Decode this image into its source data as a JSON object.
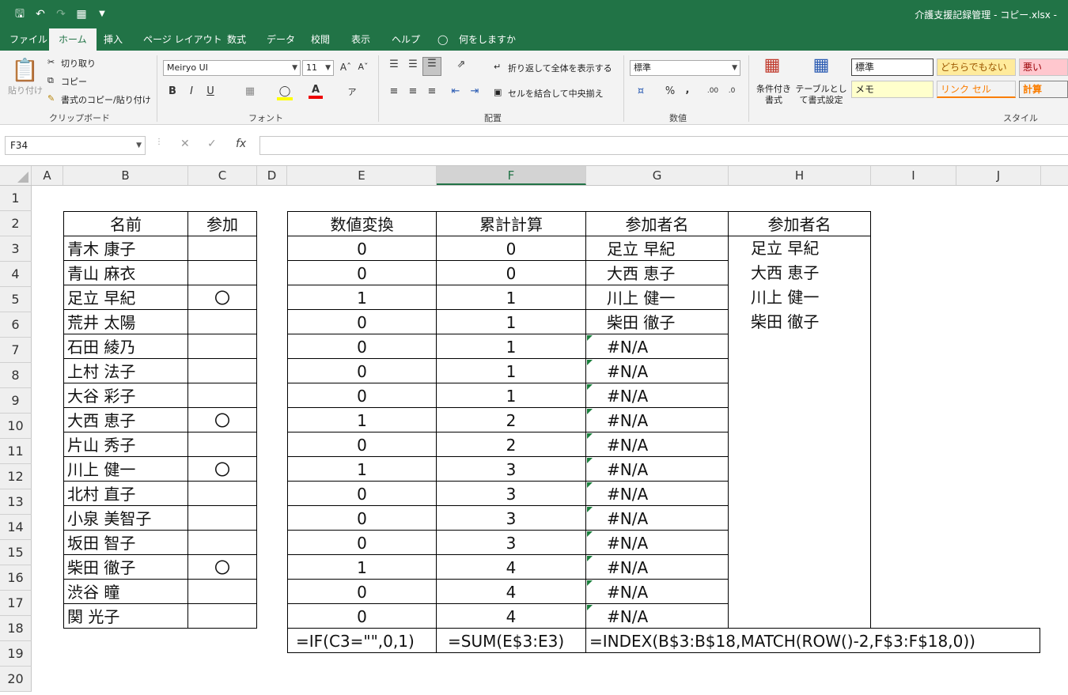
{
  "window": {
    "title": "介護支援記録管理 - コピー.xlsx  -"
  },
  "qat": {
    "save_icon": "save-icon",
    "undo_icon": "undo-icon",
    "redo_icon": "redo-icon",
    "form_icon": "form-icon",
    "customize_icon": "customize-icon"
  },
  "menu": {
    "items": [
      "ファイル",
      "ホーム",
      "挿入",
      "ページ レイアウト",
      "数式",
      "データ",
      "校閲",
      "表示",
      "ヘルプ"
    ],
    "tellme": "何をしますか",
    "active": "ホーム"
  },
  "ribbon": {
    "clipboard": {
      "paste": "貼り付け",
      "cut": "切り取り",
      "copy": "コピー",
      "format_painter": "書式のコピー/貼り付け",
      "label": "クリップボード"
    },
    "font": {
      "name": "Meiryo UI",
      "size": "11",
      "bold": "B",
      "italic": "I",
      "underline": "U",
      "label": "フォント"
    },
    "alignment": {
      "wrap": "折り返して全体を表示する",
      "merge": "セルを結合して中央揃え",
      "label": "配置"
    },
    "number": {
      "format": "標準",
      "label": "数値"
    },
    "styles": {
      "conditional": "条件付き書式",
      "table": "テーブルとして書式設定",
      "normal": "標準",
      "neutral": "どちらでもない",
      "bad": "悪い",
      "memo": "メモ",
      "link_cell": "リンク セル",
      "calc": "計算",
      "label": "スタイル"
    },
    "colors": {
      "neutral_bg": "#ffeb9c",
      "bad_bg": "#ffc7ce",
      "memo_bg": "#ffffcc",
      "calc_bg": "#f2f2f2"
    }
  },
  "formula_bar": {
    "name_box": "F34",
    "cancel": "✕",
    "enter": "✓",
    "fx": "fx",
    "content": ""
  },
  "columns": [
    "A",
    "B",
    "C",
    "D",
    "E",
    "F",
    "G",
    "H",
    "I",
    "J"
  ],
  "selected_column": "F",
  "rows": [
    "1",
    "2",
    "3",
    "4",
    "5",
    "6",
    "7",
    "8",
    "9",
    "10",
    "11",
    "12",
    "13",
    "14",
    "15",
    "16",
    "17",
    "18",
    "19",
    "20"
  ],
  "table1": {
    "header": {
      "name": "名前",
      "join": "参加"
    },
    "rows": [
      {
        "name": "青木 康子",
        "join": ""
      },
      {
        "name": "青山 麻衣",
        "join": ""
      },
      {
        "name": "足立 早紀",
        "join": "〇"
      },
      {
        "name": "荒井 太陽",
        "join": ""
      },
      {
        "name": "石田 綾乃",
        "join": ""
      },
      {
        "name": "上村 法子",
        "join": ""
      },
      {
        "name": "大谷 彩子",
        "join": ""
      },
      {
        "name": "大西 恵子",
        "join": "〇"
      },
      {
        "name": "片山 秀子",
        "join": ""
      },
      {
        "name": "川上 健一",
        "join": "〇"
      },
      {
        "name": "北村 直子",
        "join": ""
      },
      {
        "name": "小泉 美智子",
        "join": ""
      },
      {
        "name": "坂田 智子",
        "join": ""
      },
      {
        "name": "柴田 徹子",
        "join": "〇"
      },
      {
        "name": "渋谷 瞳",
        "join": ""
      },
      {
        "name": "関 光子",
        "join": ""
      }
    ]
  },
  "table2": {
    "header": {
      "e": "数値変換",
      "f": "累計計算",
      "g": "参加者名",
      "h": "参加者名"
    },
    "rows": [
      {
        "e": "0",
        "f": "0",
        "g": "足立 早紀",
        "h": "足立 早紀"
      },
      {
        "e": "0",
        "f": "0",
        "g": "大西 恵子",
        "h": "大西 恵子"
      },
      {
        "e": "1",
        "f": "1",
        "g": "川上 健一",
        "h": "川上 健一"
      },
      {
        "e": "0",
        "f": "1",
        "g": "柴田 徹子",
        "h": "柴田 徹子"
      },
      {
        "e": "0",
        "f": "1",
        "g": "#N/A",
        "h": ""
      },
      {
        "e": "0",
        "f": "1",
        "g": "#N/A",
        "h": ""
      },
      {
        "e": "0",
        "f": "1",
        "g": "#N/A",
        "h": ""
      },
      {
        "e": "1",
        "f": "2",
        "g": "#N/A",
        "h": ""
      },
      {
        "e": "0",
        "f": "2",
        "g": "#N/A",
        "h": ""
      },
      {
        "e": "1",
        "f": "3",
        "g": "#N/A",
        "h": ""
      },
      {
        "e": "0",
        "f": "3",
        "g": "#N/A",
        "h": ""
      },
      {
        "e": "0",
        "f": "3",
        "g": "#N/A",
        "h": ""
      },
      {
        "e": "0",
        "f": "3",
        "g": "#N/A",
        "h": ""
      },
      {
        "e": "1",
        "f": "4",
        "g": "#N/A",
        "h": ""
      },
      {
        "e": "0",
        "f": "4",
        "g": "#N/A",
        "h": ""
      },
      {
        "e": "0",
        "f": "4",
        "g": "#N/A",
        "h": ""
      }
    ],
    "formulas": {
      "e": "=IF(C3=\"\",0,1)",
      "f": "=SUM(E$3:E3)",
      "g": "=INDEX(B$3:B$18,MATCH(ROW()-2,F$3:F$18,0))"
    }
  },
  "colors": {
    "excel_green": "#217346",
    "error_triangle": "#1a7f3c"
  }
}
